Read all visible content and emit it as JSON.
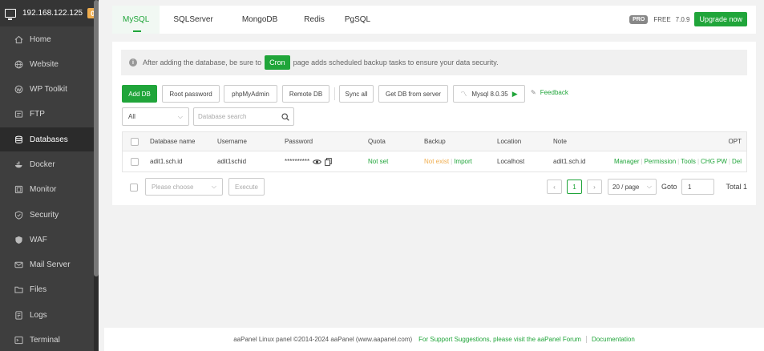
{
  "sidebar": {
    "server": "192.168.122.125",
    "badge": "0",
    "items": [
      {
        "label": "Home",
        "icon": "home-icon"
      },
      {
        "label": "Website",
        "icon": "globe-icon"
      },
      {
        "label": "WP Toolkit",
        "icon": "wordpress-icon"
      },
      {
        "label": "FTP",
        "icon": "ftp-icon"
      },
      {
        "label": "Databases",
        "icon": "database-icon"
      },
      {
        "label": "Docker",
        "icon": "docker-icon"
      },
      {
        "label": "Monitor",
        "icon": "monitor-icon"
      },
      {
        "label": "Security",
        "icon": "shield-icon"
      },
      {
        "label": "WAF",
        "icon": "waf-shield-icon"
      },
      {
        "label": "Mail Server",
        "icon": "mail-icon"
      },
      {
        "label": "Files",
        "icon": "folder-icon"
      },
      {
        "label": "Logs",
        "icon": "logs-icon"
      },
      {
        "label": "Terminal",
        "icon": "terminal-icon"
      }
    ]
  },
  "tabs": [
    "MySQL",
    "SQLServer",
    "MongoDB",
    "Redis",
    "PgSQL"
  ],
  "header": {
    "pro": "PRO",
    "free": "FREE",
    "version": "7.0.9",
    "upgrade": "Upgrade now"
  },
  "notice": {
    "before": "After adding the database, be sure to",
    "cron": "Cron",
    "after": "page adds scheduled backup tasks to ensure your data security."
  },
  "toolbar": {
    "add_db": "Add DB",
    "root_password": "Root password",
    "phpmyadmin": "phpMyAdmin",
    "remote_db": "Remote DB",
    "sync_all": "Sync all",
    "get_db": "Get DB from server",
    "mysql_version": "Mysql 8.0.35",
    "feedback": "Feedback"
  },
  "filter": {
    "selected": "All",
    "search_placeholder": "Database search"
  },
  "table": {
    "headers": {
      "name": "Database name",
      "username": "Username",
      "password": "Password",
      "quota": "Quota",
      "backup": "Backup",
      "location": "Location",
      "note": "Note",
      "opt": "OPT"
    },
    "rows": [
      {
        "name": "adit1.sch.id",
        "username": "adit1schid",
        "password": "**********",
        "quota": "Not set",
        "backup_status": "Not exist",
        "backup_import": "Import",
        "location": "Localhost",
        "note": "adit1.sch.id",
        "actions": [
          "Manager",
          "Permission",
          "Tools",
          "CHG PW",
          "Del"
        ]
      }
    ]
  },
  "batch": {
    "placeholder": "Please choose",
    "execute": "Execute"
  },
  "pagination": {
    "current": "1",
    "per_page": "20 / page",
    "goto_label": "Goto",
    "goto_value": "1",
    "total": "Total 1"
  },
  "footer": {
    "copyright": "aaPanel Linux panel ©2014-2024 aaPanel (www.aapanel.com)",
    "support": "For Support Suggestions, please visit the aaPanel Forum",
    "docs": "Documentation"
  }
}
